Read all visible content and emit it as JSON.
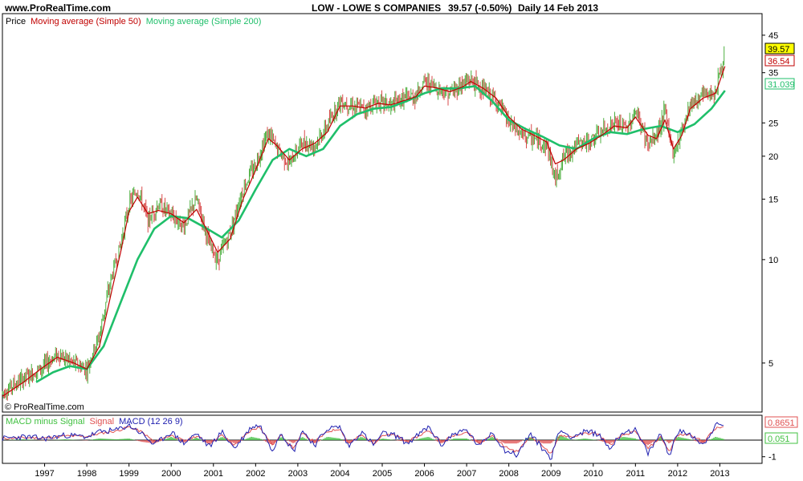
{
  "header": {
    "site": "www.ProRealTime.com",
    "instrument": "LOW - LOWE S COMPANIES",
    "last": "39.57 (-0.50%)",
    "period": "Daily  14 Feb 2013"
  },
  "watermark": "© ProRealTime.com",
  "colors": {
    "price_up": "#4caf3f",
    "price_down": "#d84a4a",
    "ma50": "#c00000",
    "ma200": "#1fbf6a",
    "macd": "#2020b0",
    "signal": "#e05050",
    "hist": "#40c040",
    "last_tag_bg": "#ffff00"
  },
  "chart_data": [
    {
      "type": "line",
      "title": "",
      "legend": [
        "Price",
        "Moving average (Simple 50)",
        "Moving average (Simple 200)"
      ],
      "x_ticks": [
        "1997",
        "1998",
        "1999",
        "2000",
        "2001",
        "2002",
        "2003",
        "2004",
        "2005",
        "2006",
        "2007",
        "2008",
        "2009",
        "2010",
        "2011",
        "2012",
        "2013"
      ],
      "y_scale": "log",
      "y_ticks": [
        5,
        10,
        15,
        20,
        25,
        35,
        45
      ],
      "ylim": [
        3.6,
        52
      ],
      "xlim": [
        1996.0,
        2014.0
      ],
      "last_values": {
        "price": "39.57",
        "ma50": "36.54",
        "ma200": "31.039"
      },
      "series": [
        {
          "name": "Price",
          "x": [
            1996.0,
            1996.5,
            1996.9,
            1997.3,
            1997.7,
            1998.0,
            1998.3,
            1998.6,
            1998.8,
            1999.0,
            1999.2,
            1999.45,
            1999.7,
            2000.0,
            2000.3,
            2000.6,
            2000.9,
            2001.1,
            2001.4,
            2001.7,
            2002.0,
            2002.3,
            2002.5,
            2002.8,
            2003.1,
            2003.4,
            2003.7,
            2004.0,
            2004.3,
            2004.6,
            2004.9,
            2005.2,
            2005.5,
            2005.8,
            2006.0,
            2006.3,
            2006.6,
            2006.9,
            2007.1,
            2007.4,
            2007.7,
            2008.0,
            2008.3,
            2008.6,
            2008.9,
            2009.1,
            2009.3,
            2009.6,
            2009.9,
            2010.2,
            2010.5,
            2010.8,
            2011.0,
            2011.3,
            2011.5,
            2011.7,
            2011.9,
            2012.1,
            2012.3,
            2012.6,
            2012.9,
            2013.12
          ],
          "values": [
            4.1,
            4.5,
            4.8,
            5.3,
            5.0,
            4.8,
            6.0,
            9.0,
            11.0,
            14.5,
            16.0,
            13.0,
            14.5,
            13.5,
            12.5,
            15.0,
            11.0,
            10.0,
            12.0,
            16.0,
            19.0,
            23.5,
            21.0,
            19.0,
            22.0,
            21.5,
            24.5,
            29.0,
            28.0,
            27.5,
            29.0,
            28.0,
            29.5,
            30.0,
            33.0,
            31.5,
            30.5,
            32.5,
            33.5,
            31.0,
            29.0,
            25.0,
            23.0,
            22.5,
            21.5,
            17.0,
            20.0,
            21.5,
            22.0,
            23.5,
            25.0,
            24.0,
            27.0,
            21.5,
            23.0,
            27.0,
            20.0,
            24.0,
            28.5,
            30.0,
            31.0,
            39.57
          ]
        },
        {
          "name": "Moving average (Simple 50)",
          "x": [
            1996.0,
            1996.5,
            1996.9,
            1997.3,
            1997.7,
            1998.0,
            1998.3,
            1998.6,
            1998.8,
            1999.0,
            1999.2,
            1999.45,
            1999.7,
            2000.0,
            2000.3,
            2000.6,
            2000.9,
            2001.1,
            2001.4,
            2001.7,
            2002.0,
            2002.3,
            2002.5,
            2002.8,
            2003.1,
            2003.4,
            2003.7,
            2004.0,
            2004.3,
            2004.6,
            2004.9,
            2005.2,
            2005.5,
            2005.8,
            2006.0,
            2006.3,
            2006.6,
            2006.9,
            2007.1,
            2007.4,
            2007.7,
            2008.0,
            2008.3,
            2008.6,
            2008.9,
            2009.1,
            2009.3,
            2009.6,
            2009.9,
            2010.2,
            2010.5,
            2010.8,
            2011.0,
            2011.3,
            2011.5,
            2011.7,
            2011.9,
            2012.1,
            2012.3,
            2012.6,
            2012.9,
            2013.12
          ],
          "values": [
            4.0,
            4.4,
            4.8,
            5.2,
            5.0,
            4.8,
            5.6,
            8.2,
            10.5,
            13.8,
            15.2,
            13.6,
            13.9,
            13.6,
            12.8,
            14.0,
            11.8,
            10.5,
            11.5,
            15.0,
            18.2,
            22.5,
            21.5,
            19.5,
            21.0,
            21.8,
            23.5,
            28.0,
            28.0,
            27.6,
            28.5,
            28.2,
            29.0,
            29.8,
            32.0,
            31.6,
            30.8,
            31.8,
            33.0,
            31.5,
            29.5,
            26.0,
            24.0,
            23.0,
            22.0,
            19.0,
            19.5,
            21.0,
            21.8,
            23.0,
            24.5,
            24.2,
            26.0,
            23.0,
            22.5,
            25.5,
            21.0,
            23.0,
            27.5,
            29.5,
            30.5,
            36.54
          ]
        },
        {
          "name": "Moving average (Simple 200)",
          "x": [
            1996.8,
            1997.2,
            1997.6,
            1998.0,
            1998.4,
            1998.8,
            1999.2,
            1999.6,
            2000.0,
            2000.4,
            2000.8,
            2001.2,
            2001.6,
            2002.0,
            2002.4,
            2002.8,
            2003.2,
            2003.6,
            2004.0,
            2004.4,
            2004.8,
            2005.2,
            2005.6,
            2006.0,
            2006.4,
            2006.8,
            2007.2,
            2007.6,
            2008.0,
            2008.4,
            2008.8,
            2009.2,
            2009.6,
            2010.0,
            2010.4,
            2010.8,
            2011.2,
            2011.6,
            2012.0,
            2012.4,
            2012.8,
            2013.12
          ],
          "values": [
            4.4,
            4.7,
            4.9,
            4.8,
            5.6,
            7.5,
            10.0,
            12.3,
            13.4,
            13.2,
            12.4,
            11.6,
            13.0,
            16.0,
            19.5,
            21.0,
            20.0,
            21.0,
            24.5,
            26.5,
            27.5,
            27.8,
            29.0,
            30.5,
            31.5,
            31.5,
            32.0,
            29.0,
            25.5,
            24.0,
            22.8,
            21.5,
            21.0,
            22.5,
            23.5,
            23.2,
            24.0,
            24.5,
            23.5,
            24.8,
            27.5,
            31.039
          ]
        }
      ]
    },
    {
      "type": "line",
      "title": "",
      "legend": [
        "MACD minus Signal",
        "Signal",
        "MACD (12 26 9)"
      ],
      "y_ticks": [
        -1
      ],
      "ylim": [
        -1.4,
        1.5
      ],
      "xlim": [
        1996.0,
        2014.0
      ],
      "last_values": {
        "macd": "0.8651",
        "hist": "0.051"
      },
      "series": [
        {
          "name": "MACD (12 26 9)",
          "x": [
            1996.0,
            1996.5,
            1997.0,
            1997.5,
            1998.0,
            1998.3,
            1998.7,
            1999.0,
            1999.3,
            1999.6,
            2000.0,
            2000.3,
            2000.6,
            2000.9,
            2001.2,
            2001.5,
            2001.9,
            2002.1,
            2002.4,
            2002.6,
            2002.9,
            2003.1,
            2003.4,
            2003.7,
            2004.0,
            2004.2,
            2004.5,
            2004.8,
            2005.0,
            2005.3,
            2005.6,
            2005.9,
            2006.1,
            2006.4,
            2006.7,
            2007.0,
            2007.3,
            2007.6,
            2007.9,
            2008.2,
            2008.5,
            2008.8,
            2009.0,
            2009.2,
            2009.5,
            2009.8,
            2010.1,
            2010.4,
            2010.7,
            2011.0,
            2011.3,
            2011.6,
            2011.8,
            2012.0,
            2012.3,
            2012.6,
            2012.9,
            2013.12
          ],
          "values": [
            0.1,
            0.2,
            0.1,
            0.3,
            0.2,
            0.5,
            0.6,
            0.9,
            0.4,
            -0.3,
            0.5,
            -0.2,
            0.4,
            -0.4,
            0.5,
            -0.5,
            0.8,
            0.9,
            -0.6,
            0.5,
            -0.7,
            0.6,
            -0.3,
            0.7,
            0.8,
            -0.4,
            0.5,
            -0.3,
            0.4,
            0.3,
            -0.2,
            0.4,
            0.8,
            -0.3,
            0.4,
            0.6,
            -0.4,
            0.5,
            -0.6,
            -0.9,
            0.4,
            -0.5,
            -1.1,
            0.6,
            0.2,
            0.5,
            0.4,
            -0.5,
            0.5,
            0.6,
            -0.8,
            0.4,
            -0.9,
            0.5,
            0.4,
            -0.3,
            0.9,
            0.8651
          ]
        },
        {
          "name": "Signal",
          "x": [
            1996.0,
            1996.5,
            1997.0,
            1997.5,
            1998.0,
            1998.3,
            1998.7,
            1999.0,
            1999.3,
            1999.6,
            2000.0,
            2000.3,
            2000.6,
            2000.9,
            2001.2,
            2001.5,
            2001.9,
            2002.1,
            2002.4,
            2002.6,
            2002.9,
            2003.1,
            2003.4,
            2003.7,
            2004.0,
            2004.2,
            2004.5,
            2004.8,
            2005.0,
            2005.3,
            2005.6,
            2005.9,
            2006.1,
            2006.4,
            2006.7,
            2007.0,
            2007.3,
            2007.6,
            2007.9,
            2008.2,
            2008.5,
            2008.8,
            2009.0,
            2009.2,
            2009.5,
            2009.8,
            2010.1,
            2010.4,
            2010.7,
            2011.0,
            2011.3,
            2011.6,
            2011.8,
            2012.0,
            2012.3,
            2012.6,
            2012.9,
            2013.12
          ],
          "values": [
            0.1,
            0.15,
            0.12,
            0.25,
            0.22,
            0.4,
            0.55,
            0.8,
            0.5,
            -0.1,
            0.3,
            -0.05,
            0.25,
            -0.2,
            0.3,
            -0.3,
            0.6,
            0.8,
            -0.3,
            0.3,
            -0.5,
            0.4,
            -0.1,
            0.5,
            0.7,
            -0.2,
            0.3,
            -0.2,
            0.3,
            0.3,
            -0.1,
            0.3,
            0.6,
            -0.1,
            0.3,
            0.5,
            -0.2,
            0.3,
            -0.4,
            -0.7,
            0.2,
            -0.3,
            -0.9,
            0.3,
            0.2,
            0.4,
            0.4,
            -0.3,
            0.3,
            0.5,
            -0.5,
            0.2,
            -0.7,
            0.3,
            0.35,
            -0.1,
            0.7,
            0.8141
          ]
        }
      ]
    }
  ]
}
